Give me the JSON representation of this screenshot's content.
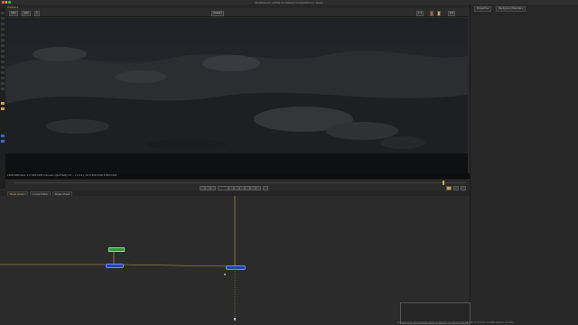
{
  "app": {
    "window_title": "Shakedown_v0TPa.nk (Saved Composition) - Nuke",
    "viewer_tab": "Viewer1"
  },
  "viewer_toolbar": {
    "channels": "rgba",
    "layer": "rgba",
    "input": "A",
    "compare": "",
    "viewer_label": "Viewer1",
    "zoom": "1:1",
    "proxy": "ext"
  },
  "viewer_info": "1920x1080 bbox: 0 0 1920 1080 channels: rgba  fidelity 2.0  ... x 1111 y 311  0.000 0.000 0.000 0.000",
  "timeline": {
    "frame": "1001",
    "in_label": "1001",
    "out_label": "1100"
  },
  "node_tabs": [
    {
      "label": "Node Graph",
      "active": true
    },
    {
      "label": "Curve Editor",
      "active": false
    },
    {
      "label": "Dope Sheet",
      "active": false
    }
  ],
  "right_panel": {
    "tabs": [
      "Properties",
      "Background Renders"
    ]
  },
  "nodes": {
    "read": "Read1",
    "reformat": "Reformat1",
    "merge": "Merge1"
  },
  "status": "Channel Count: 18  Localization Mode: On  Memory: 2.1 GB (3%) 200 MB  CPU: 10.5%  Disk: 0.0 MB/s  Network: 0.0 MB/s",
  "colors": {
    "accent": "#d6a243",
    "node_blue": "#2346a8",
    "node_green": "#3a8f3a",
    "wire": "#c9a05a"
  }
}
